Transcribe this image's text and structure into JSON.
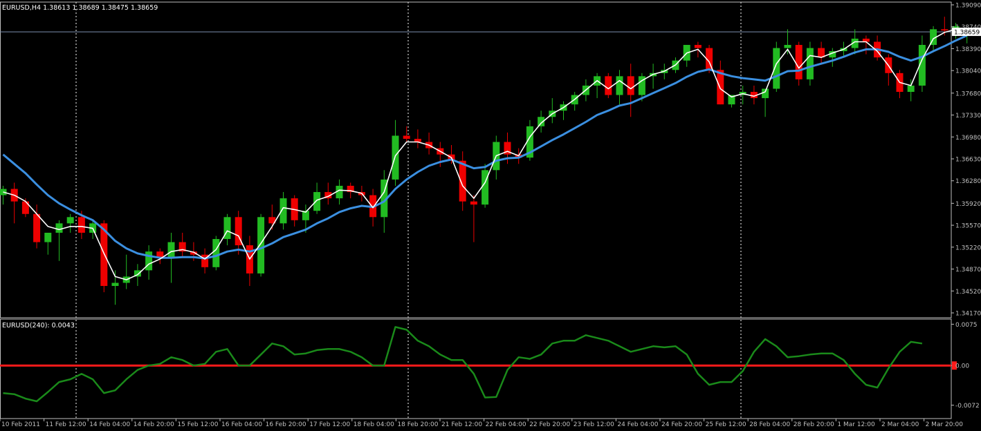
{
  "header": {
    "symbol_info": "EURUSD,H4  1.38613 1.38689 1.38475 1.38659",
    "indicator_info": "EURUSD(240):  0.0043"
  },
  "colors": {
    "background": "#000000",
    "axis": "#c0c0c0",
    "grid": "#ffffff",
    "bull": "#22bb22",
    "bear": "#ee0000",
    "ma_fast": "#ffffff",
    "ma_slow": "#3b8fe0",
    "osc_line": "#1a8a1a",
    "zero_line": "#ff1a1a",
    "price_label_bg": "#ffffff",
    "price_label_fg": "#000000"
  },
  "chart_data": [
    {
      "type": "candlestick",
      "symbol": "EURUSD",
      "timeframe": "H4",
      "ylim": [
        1.3417,
        1.3909
      ],
      "y_ticks": [
        "1.39090",
        "1.38740",
        "1.38390",
        "1.38040",
        "1.37680",
        "1.37330",
        "1.36980",
        "1.36630",
        "1.36280",
        "1.35920",
        "1.35570",
        "1.35220",
        "1.34870",
        "1.34520",
        "1.34170"
      ],
      "current_price": "1.38659",
      "current_price_value": 1.38659,
      "grid": "vertical dashed at 11 Feb 12:00, 18 Feb 20:00, 25 Feb 12:00",
      "candles": [
        [
          1.3605,
          1.362,
          1.359,
          1.3615
        ],
        [
          1.3615,
          1.3625,
          1.356,
          1.3595
        ],
        [
          1.3595,
          1.36,
          1.357,
          1.3575
        ],
        [
          1.3575,
          1.359,
          1.352,
          1.353
        ],
        [
          1.353,
          1.3545,
          1.351,
          1.3545
        ],
        [
          1.3545,
          1.3565,
          1.35,
          1.356
        ],
        [
          1.356,
          1.3575,
          1.3545,
          1.357
        ],
        [
          1.357,
          1.358,
          1.3535,
          1.3545
        ],
        [
          1.3545,
          1.3565,
          1.3535,
          1.356
        ],
        [
          1.356,
          1.3565,
          1.345,
          1.346
        ],
        [
          1.346,
          1.3485,
          1.343,
          1.3465
        ],
        [
          1.3465,
          1.351,
          1.3455,
          1.3475
        ],
        [
          1.3475,
          1.3495,
          1.346,
          1.3485
        ],
        [
          1.3485,
          1.3525,
          1.347,
          1.3515
        ],
        [
          1.3515,
          1.352,
          1.3495,
          1.3505
        ],
        [
          1.3505,
          1.3545,
          1.3465,
          1.353
        ],
        [
          1.353,
          1.3545,
          1.3505,
          1.3515
        ],
        [
          1.3515,
          1.353,
          1.35,
          1.351
        ],
        [
          1.351,
          1.352,
          1.348,
          1.349
        ],
        [
          1.349,
          1.354,
          1.3485,
          1.3535
        ],
        [
          1.3535,
          1.3575,
          1.3525,
          1.357
        ],
        [
          1.357,
          1.358,
          1.351,
          1.3525
        ],
        [
          1.3525,
          1.354,
          1.346,
          1.348
        ],
        [
          1.348,
          1.3575,
          1.3475,
          1.357
        ],
        [
          1.357,
          1.359,
          1.355,
          1.356
        ],
        [
          1.356,
          1.361,
          1.355,
          1.36
        ],
        [
          1.36,
          1.3605,
          1.3555,
          1.3565
        ],
        [
          1.3565,
          1.359,
          1.3545,
          1.358
        ],
        [
          1.358,
          1.3625,
          1.3575,
          1.361
        ],
        [
          1.361,
          1.3625,
          1.359,
          1.36
        ],
        [
          1.36,
          1.363,
          1.359,
          1.362
        ],
        [
          1.362,
          1.3625,
          1.36,
          1.361
        ],
        [
          1.361,
          1.362,
          1.3595,
          1.3605
        ],
        [
          1.3605,
          1.3615,
          1.3555,
          1.357
        ],
        [
          1.357,
          1.3645,
          1.3545,
          1.363
        ],
        [
          1.363,
          1.3725,
          1.362,
          1.37
        ],
        [
          1.37,
          1.3715,
          1.369,
          1.3695
        ],
        [
          1.3695,
          1.371,
          1.368,
          1.369
        ],
        [
          1.369,
          1.3705,
          1.367,
          1.368
        ],
        [
          1.368,
          1.369,
          1.365,
          1.367
        ],
        [
          1.367,
          1.3685,
          1.3655,
          1.366
        ],
        [
          1.366,
          1.3675,
          1.358,
          1.3595
        ],
        [
          1.3595,
          1.3605,
          1.353,
          1.359
        ],
        [
          1.359,
          1.3655,
          1.3585,
          1.3645
        ],
        [
          1.3645,
          1.37,
          1.363,
          1.369
        ],
        [
          1.369,
          1.3705,
          1.3655,
          1.367
        ],
        [
          1.367,
          1.368,
          1.3655,
          1.3665
        ],
        [
          1.3665,
          1.3725,
          1.366,
          1.3715
        ],
        [
          1.3715,
          1.374,
          1.3705,
          1.373
        ],
        [
          1.373,
          1.376,
          1.372,
          1.374
        ],
        [
          1.374,
          1.3755,
          1.3725,
          1.375
        ],
        [
          1.375,
          1.377,
          1.374,
          1.3765
        ],
        [
          1.3765,
          1.379,
          1.3755,
          1.378
        ],
        [
          1.378,
          1.38,
          1.376,
          1.3795
        ],
        [
          1.3795,
          1.38,
          1.376,
          1.3765
        ],
        [
          1.3765,
          1.3805,
          1.375,
          1.3795
        ],
        [
          1.3795,
          1.3815,
          1.373,
          1.3765
        ],
        [
          1.3765,
          1.38,
          1.3755,
          1.3795
        ],
        [
          1.3795,
          1.3815,
          1.3775,
          1.38
        ],
        [
          1.38,
          1.3815,
          1.379,
          1.3805
        ],
        [
          1.3805,
          1.3825,
          1.38,
          1.382
        ],
        [
          1.382,
          1.3845,
          1.381,
          1.3845
        ],
        [
          1.3845,
          1.385,
          1.3825,
          1.384
        ],
        [
          1.384,
          1.3845,
          1.38,
          1.3805
        ],
        [
          1.3805,
          1.382,
          1.375,
          1.375
        ],
        [
          1.375,
          1.3765,
          1.3745,
          1.3765
        ],
        [
          1.3765,
          1.378,
          1.375,
          1.377
        ],
        [
          1.377,
          1.378,
          1.375,
          1.376
        ],
        [
          1.376,
          1.3775,
          1.373,
          1.3775
        ],
        [
          1.3775,
          1.385,
          1.377,
          1.384
        ],
        [
          1.384,
          1.387,
          1.383,
          1.3845
        ],
        [
          1.3845,
          1.385,
          1.378,
          1.379
        ],
        [
          1.379,
          1.385,
          1.378,
          1.384
        ],
        [
          1.384,
          1.385,
          1.3815,
          1.3825
        ],
        [
          1.3825,
          1.384,
          1.381,
          1.3835
        ],
        [
          1.3835,
          1.385,
          1.3825,
          1.384
        ],
        [
          1.384,
          1.387,
          1.383,
          1.3855
        ],
        [
          1.3855,
          1.386,
          1.383,
          1.385
        ],
        [
          1.385,
          1.386,
          1.382,
          1.3825
        ],
        [
          1.3825,
          1.383,
          1.378,
          1.38
        ],
        [
          1.38,
          1.3805,
          1.376,
          1.377
        ],
        [
          1.377,
          1.379,
          1.3755,
          1.378
        ],
        [
          1.378,
          1.386,
          1.377,
          1.3845
        ],
        [
          1.3845,
          1.3875,
          1.3835,
          1.387
        ],
        [
          1.387,
          1.389,
          1.386,
          1.3868
        ],
        [
          1.3868,
          1.388,
          1.3855,
          1.3875
        ],
        [
          1.38613,
          1.38689,
          1.38475,
          1.38659
        ]
      ],
      "ma_fast": [
        1.361,
        1.3605,
        1.3595,
        1.3575,
        1.3555,
        1.355,
        1.3555,
        1.3555,
        1.3552,
        1.3512,
        1.3475,
        1.347,
        1.3478,
        1.3495,
        1.3503,
        1.3515,
        1.3518,
        1.3514,
        1.3503,
        1.3518,
        1.3548,
        1.354,
        1.3503,
        1.3528,
        1.3555,
        1.3585,
        1.3582,
        1.3578,
        1.3597,
        1.3603,
        1.3613,
        1.3612,
        1.3608,
        1.3585,
        1.361,
        1.3668,
        1.369,
        1.369,
        1.3685,
        1.3675,
        1.3665,
        1.362,
        1.36,
        1.3625,
        1.3668,
        1.3675,
        1.3668,
        1.3698,
        1.372,
        1.3735,
        1.3745,
        1.3758,
        1.3773,
        1.3788,
        1.3775,
        1.3788,
        1.3775,
        1.3788,
        1.3798,
        1.3803,
        1.3813,
        1.3832,
        1.3838,
        1.3818,
        1.3775,
        1.3762,
        1.3767,
        1.3763,
        1.377,
        1.3815,
        1.3838,
        1.3808,
        1.3828,
        1.3825,
        1.3832,
        1.3838,
        1.385,
        1.385,
        1.3835,
        1.3812,
        1.3785,
        1.378,
        1.3822,
        1.3855,
        1.3865,
        1.387,
        1.3866
      ],
      "ma_slow": [
        1.367,
        1.3655,
        1.364,
        1.3622,
        1.3605,
        1.3592,
        1.3582,
        1.3573,
        1.3565,
        1.355,
        1.3532,
        1.352,
        1.3512,
        1.3508,
        1.3505,
        1.3505,
        1.3506,
        1.3506,
        1.3504,
        1.3508,
        1.3515,
        1.3518,
        1.3515,
        1.352,
        1.3528,
        1.3538,
        1.3544,
        1.355,
        1.356,
        1.3568,
        1.3578,
        1.3584,
        1.3588,
        1.3586,
        1.3595,
        1.3615,
        1.363,
        1.3642,
        1.3652,
        1.3658,
        1.3662,
        1.3655,
        1.3648,
        1.365,
        1.366,
        1.3664,
        1.3665,
        1.3673,
        1.3683,
        1.3693,
        1.3702,
        1.3712,
        1.3722,
        1.3733,
        1.374,
        1.3748,
        1.3752,
        1.376,
        1.3768,
        1.3776,
        1.3784,
        1.3794,
        1.3802,
        1.3806,
        1.38,
        1.3795,
        1.3792,
        1.379,
        1.3788,
        1.3795,
        1.3803,
        1.3804,
        1.381,
        1.3815,
        1.382,
        1.3826,
        1.3833,
        1.3838,
        1.3838,
        1.3834,
        1.3826,
        1.382,
        1.3826,
        1.3835,
        1.3843,
        1.3852,
        1.386
      ]
    },
    {
      "type": "line",
      "name": "EURUSD(240)",
      "current_value": "0.0043",
      "ylim": [
        -0.0085,
        0.0078
      ],
      "y_ticks": [
        "0.0075",
        "0.00",
        "-0.0072"
      ],
      "zero_line": 0.0,
      "values": [
        -0.005,
        -0.0052,
        -0.006,
        -0.0065,
        -0.0048,
        -0.003,
        -0.0025,
        -0.0015,
        -0.0025,
        -0.005,
        -0.0045,
        -0.0025,
        -0.0008,
        0.0,
        0.0003,
        0.0015,
        0.001,
        0.0,
        0.0003,
        0.0025,
        0.003,
        0.0,
        0.0,
        0.002,
        0.004,
        0.0035,
        0.002,
        0.0022,
        0.0028,
        0.003,
        0.003,
        0.0025,
        0.0015,
        0.0,
        0.0,
        0.007,
        0.0065,
        0.0045,
        0.0035,
        0.002,
        0.001,
        0.001,
        -0.0015,
        -0.0058,
        -0.0057,
        -0.0008,
        0.0015,
        0.0012,
        0.002,
        0.004,
        0.0045,
        0.0045,
        0.0055,
        0.005,
        0.0045,
        0.0035,
        0.0025,
        0.003,
        0.0035,
        0.0033,
        0.0035,
        0.002,
        -0.0015,
        -0.0035,
        -0.003,
        -0.003,
        -0.001,
        0.0025,
        0.0048,
        0.0035,
        0.0015,
        0.0017,
        0.002,
        0.0022,
        0.0022,
        0.001,
        -0.0015,
        -0.0035,
        -0.004,
        -0.0005,
        0.0025,
        0.0043,
        0.004
      ],
      "x_labels": [
        "10 Feb 2011",
        "11 Feb 12:00",
        "14 Feb 04:00",
        "14 Feb 20:00",
        "15 Feb 12:00",
        "16 Feb 04:00",
        "16 Feb 20:00",
        "17 Feb 12:00",
        "18 Feb 04:00",
        "18 Feb 20:00",
        "21 Feb 12:00",
        "22 Feb 04:00",
        "22 Feb 20:00",
        "23 Feb 12:00",
        "24 Feb 04:00",
        "24 Feb 20:00",
        "25 Feb 12:00",
        "28 Feb 04:00",
        "28 Feb 20:00",
        "1 Mar 12:00",
        "2 Mar 04:00",
        "2 Mar 20:00"
      ]
    }
  ]
}
